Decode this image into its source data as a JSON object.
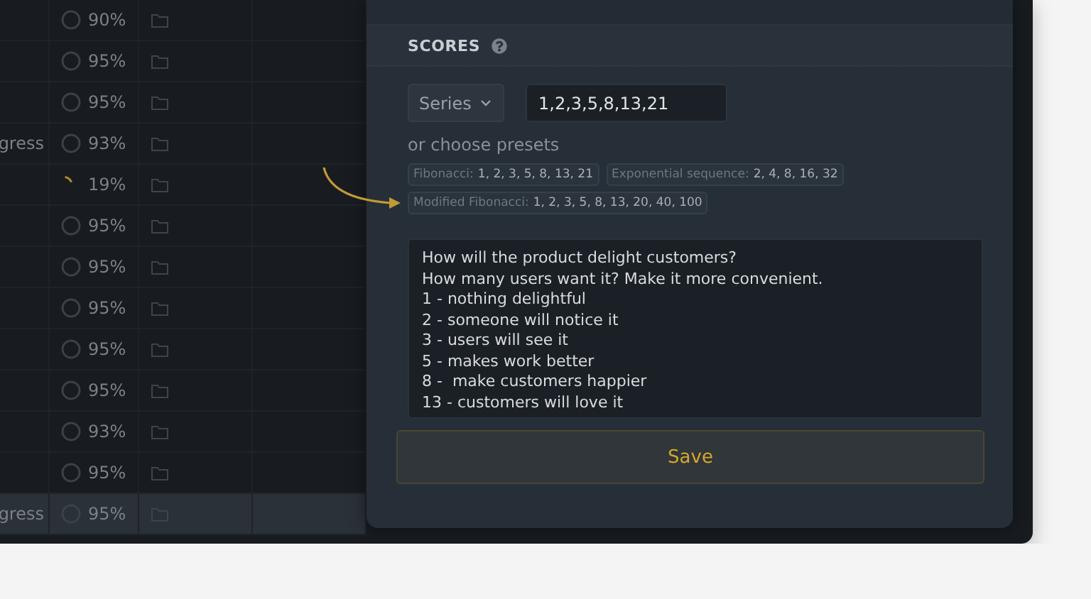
{
  "table": {
    "rows": [
      {
        "percent": "90%",
        "kind": "ring",
        "selected": false
      },
      {
        "percent": "95%",
        "kind": "ring",
        "selected": false
      },
      {
        "percent": "95%",
        "kind": "ring",
        "selected": false
      },
      {
        "status": "gress",
        "percent": "93%",
        "kind": "ring",
        "selected": false
      },
      {
        "percent": "19%",
        "kind": "spinner",
        "selected": false
      },
      {
        "percent": "95%",
        "kind": "ring",
        "selected": false
      },
      {
        "percent": "95%",
        "kind": "ring",
        "selected": false
      },
      {
        "percent": "95%",
        "kind": "ring",
        "selected": false
      },
      {
        "percent": "95%",
        "kind": "ring",
        "selected": false
      },
      {
        "percent": "95%",
        "kind": "ring",
        "selected": false
      },
      {
        "percent": "93%",
        "kind": "ring",
        "selected": false
      },
      {
        "percent": "95%",
        "kind": "ring",
        "selected": false
      },
      {
        "status": "gress",
        "percent": "95%",
        "kind": "ring",
        "selected": true
      }
    ]
  },
  "panel": {
    "section_title": "SCORES",
    "type_dropdown": "Series",
    "series_value": "1,2,3,5,8,13,21",
    "presets_label": "or choose presets",
    "presets": [
      {
        "name": "Fibonacci:",
        "values": "1, 2, 3, 5, 8, 13, 21"
      },
      {
        "name": "Exponential sequence:",
        "values": "2, 4, 8, 16, 32"
      },
      {
        "name": "Modified Fibonacci:",
        "values": "1, 2, 3, 5, 8, 13, 20, 40, 100"
      }
    ],
    "description": [
      "How will the product delight customers?",
      "How many users want it? Make it more convenient.",
      "1 - nothing delightful",
      "2 - someone will notice it",
      "3 - users will see it",
      "5 - makes work better",
      "8 -  make customers happier",
      "13 - customers will love it"
    ],
    "save_button": "Save"
  }
}
